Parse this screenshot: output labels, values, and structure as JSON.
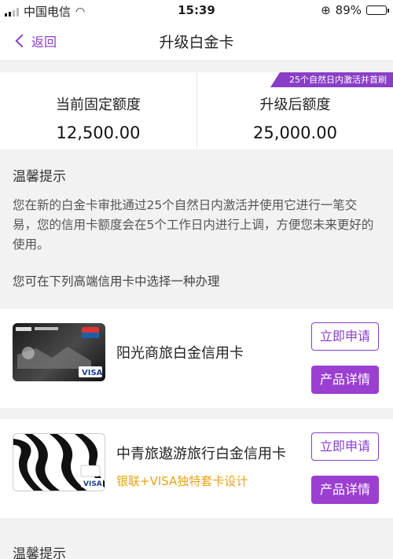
{
  "status_bar": {
    "carrier": "中国电信",
    "time": "15:39",
    "battery": "89%",
    "battery_level": 0.89
  },
  "nav": {
    "back_label": "返回",
    "title": "升级白金卡"
  },
  "quota": {
    "ribbon": "25个自然日内激活并首刷",
    "current_label": "当前固定额度",
    "current_value": "12,500.00",
    "upgraded_label": "升级后额度",
    "upgraded_value": "25,000.00"
  },
  "tips": {
    "heading": "温馨提示",
    "body": "您在新的白金卡审批通过25个自然日内激活并使用它进行一笔交易，您的信用卡额度会在5个工作日内进行上调，方便您未来更好的使用。",
    "choose": "您可在下列高端信用卡中选择一种办理"
  },
  "cards": [
    {
      "name": "阳光商旅白金信用卡",
      "subtitle": "",
      "apply_label": "立即申请",
      "detail_label": "产品详情"
    },
    {
      "name": "中青旅遨游旅行白金信用卡",
      "subtitle": "银联+VISA独特套卡设计",
      "apply_label": "立即申请",
      "detail_label": "产品详情"
    }
  ],
  "tips2": {
    "heading": "温馨提示"
  },
  "colors": {
    "accent": "#8a3ec7",
    "highlight": "#e8a317"
  }
}
